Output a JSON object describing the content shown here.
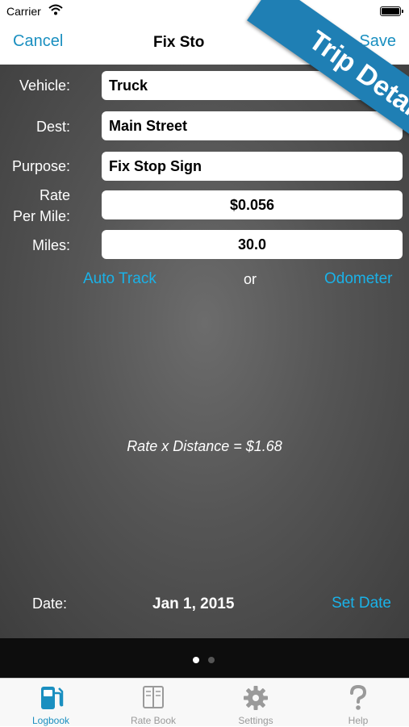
{
  "status_bar": {
    "carrier": "Carrier"
  },
  "nav": {
    "cancel": "Cancel",
    "title": "Fix Sto",
    "save": "Save"
  },
  "ribbon": {
    "text": "Trip Details"
  },
  "form": {
    "vehicle": {
      "label": "Vehicle:",
      "value": "Truck"
    },
    "dest": {
      "label": "Dest:",
      "value": "Main Street"
    },
    "purpose": {
      "label": "Purpose:",
      "value": "Fix Stop Sign"
    },
    "rate": {
      "label_line1": "Rate",
      "label_line2": "Per Mile:",
      "value": "$0.056"
    },
    "miles": {
      "label": "Miles:",
      "value": "30.0"
    }
  },
  "tracking": {
    "auto_track": "Auto Track",
    "or": "or",
    "odometer": "Odometer"
  },
  "calculation": "Rate x Distance = $1.68",
  "date": {
    "label": "Date:",
    "value": "Jan 1, 2015",
    "set_date": "Set Date"
  },
  "pager": {
    "pages": 2,
    "current": 1
  },
  "tabs": [
    {
      "label": "Logbook",
      "icon": "gas-pump-icon",
      "active": true
    },
    {
      "label": "Rate Book",
      "icon": "book-icon",
      "active": false
    },
    {
      "label": "Settings",
      "icon": "gear-icon",
      "active": false
    },
    {
      "label": "Help",
      "icon": "question-icon",
      "active": false
    }
  ],
  "colors": {
    "accent": "#1a8fc0",
    "link": "#1ab2e8",
    "ribbon": "#1f7fb4"
  }
}
